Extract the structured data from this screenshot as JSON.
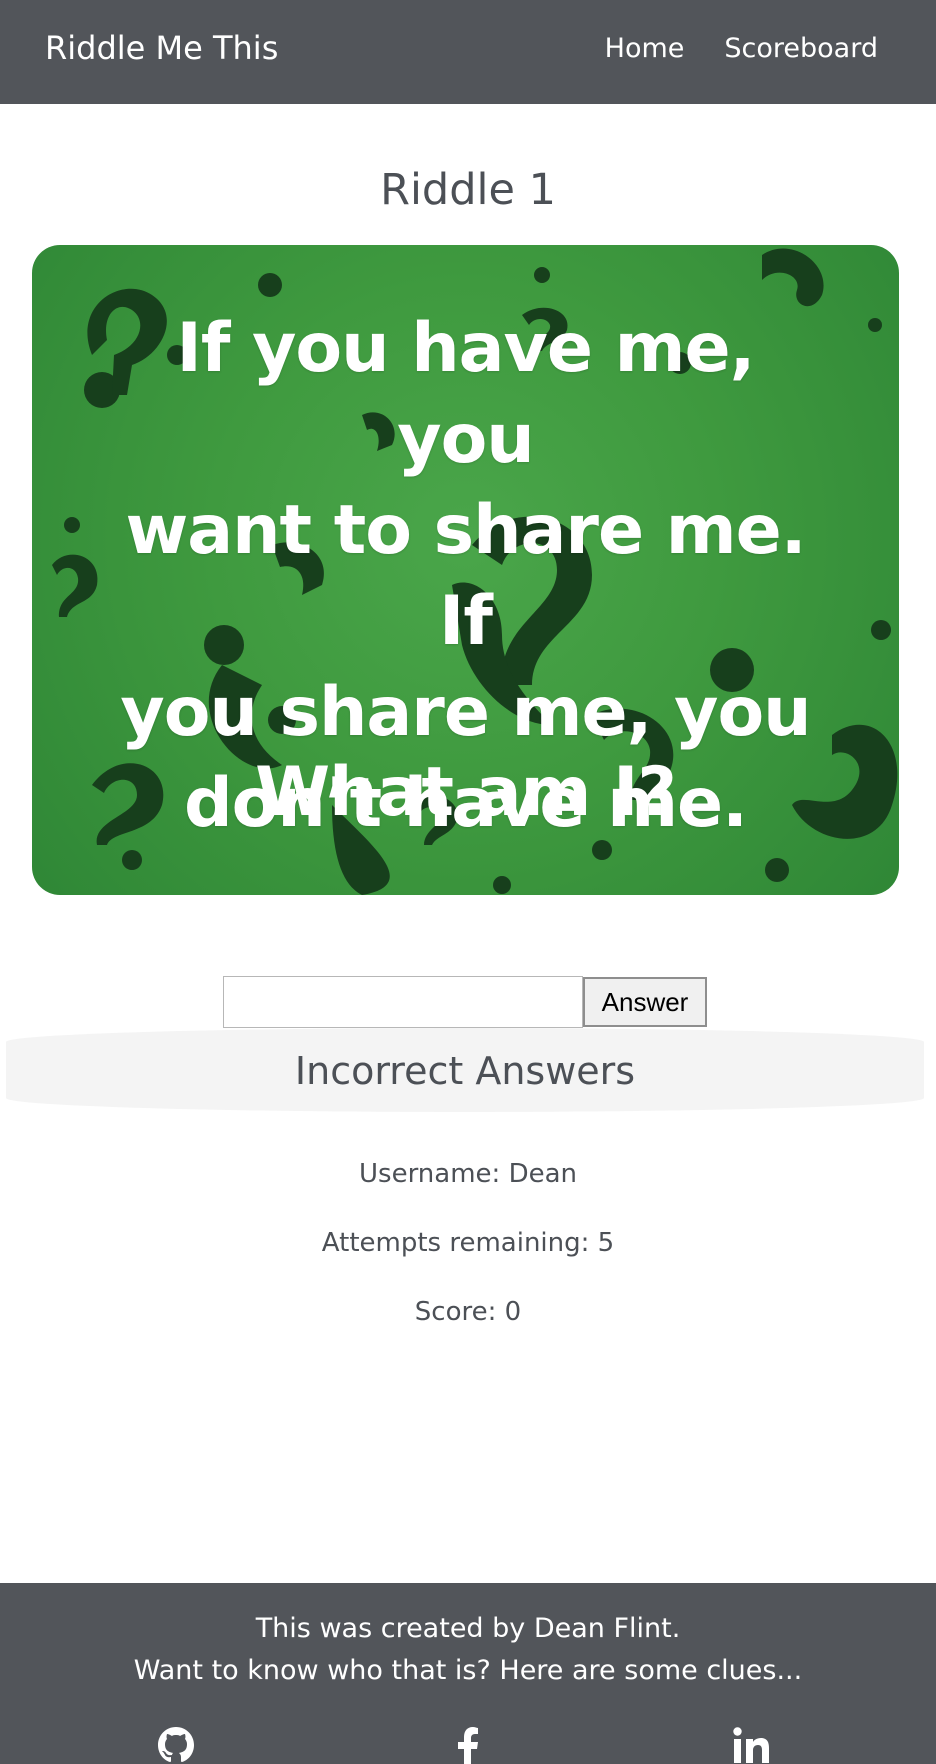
{
  "header": {
    "brand": "Riddle Me This",
    "nav": [
      "Home",
      "Scoreboard"
    ]
  },
  "main": {
    "title": "Riddle 1",
    "riddle_image": {
      "text": "If you have me, you\nwant to share me. If\nyou share me, you\ndon’t have me.",
      "question": "What am I?"
    },
    "answer_input": {
      "value": "",
      "placeholder": ""
    },
    "answer_button": "Answer",
    "incorrect_heading": "Incorrect Answers",
    "username": "Username: Dean",
    "attempts": "Attempts remaining: 5",
    "score": "Score: 0"
  },
  "footer": {
    "line1": "This was created by Dean Flint.",
    "line2": "Want to know who that is? Here are some clues...",
    "icons": [
      "github-icon",
      "facebook-icon",
      "linkedin-icon"
    ]
  },
  "colors": {
    "navbar": "#52555a",
    "text": "#4c5056",
    "riddle_green": "#3f9a3f",
    "banner": "#f4f4f4"
  }
}
